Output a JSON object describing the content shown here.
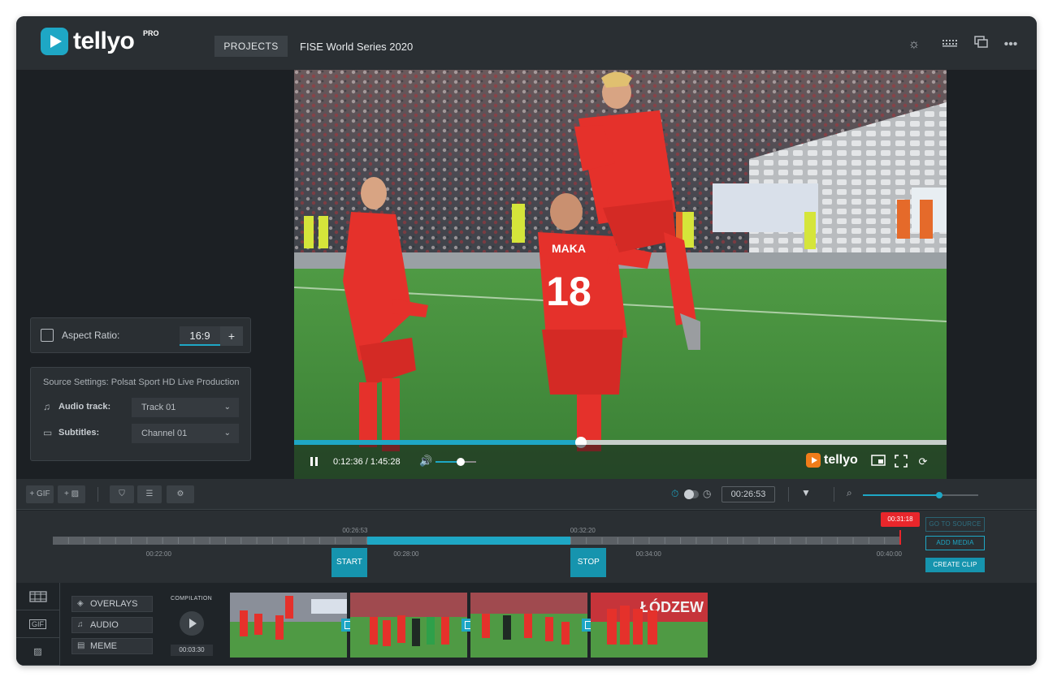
{
  "header": {
    "logo_text": "tellyo",
    "logo_badge": "PRO",
    "projects_label": "PROJECTS",
    "project_title": "FISE World Series 2020",
    "icons": [
      "brightness-icon",
      "keyboard-icon",
      "windows-icon",
      "more-icon"
    ]
  },
  "aspect": {
    "label": "Aspect Ratio:",
    "value": "16:9",
    "add": "+"
  },
  "source": {
    "title": "Source Settings: Polsat Sport HD Live Production",
    "audio_label": "Audio track:",
    "audio_value": "Track 01",
    "subtitles_label": "Subtitles:",
    "subtitles_value": "Channel 01"
  },
  "player": {
    "time": "0:12:36 / 1:45:28",
    "progress": 0.44,
    "volume": 0.62,
    "watermark": "tellyo",
    "jersey_name": "MAKA",
    "jersey_number": "18"
  },
  "toolbar": {
    "gif_label": "+ GIF",
    "img_label": "+",
    "time": "00:26:53",
    "zoom": 0.66
  },
  "timeline": {
    "ticks": [
      {
        "pos": 0.125,
        "label": "00:22:00"
      },
      {
        "pos": 0.417,
        "label": "00:28:00"
      },
      {
        "pos": 0.703,
        "label": "00:34:00"
      },
      {
        "pos": 0.987,
        "label": "00:40:00"
      }
    ],
    "sel_start": 0.371,
    "sel_end": 0.611,
    "start_time": "00:26:53",
    "end_time": "00:32:20",
    "start_label": "START",
    "stop_label": "STOP",
    "playhead": 1.0,
    "playhead_time": "00:31:18",
    "go_to_source": "GO TO SOURCE",
    "add_media": "ADD MEDIA",
    "create_clip": "CREATE CLIP"
  },
  "bottom": {
    "tabs": [
      "filmstrip-icon",
      "GIF",
      "image-icon"
    ],
    "overlays": "OVERLAYS",
    "audio": "AUDIO",
    "meme": "MEME",
    "compilation": "COMPILATION",
    "compilation_time": "00:03:30",
    "banner_text": "ŁÓDZEW"
  },
  "colors": {
    "accent": "#1ea7c5",
    "playhead": "#e8262b",
    "jersey": "#e5312b",
    "pitch": "#3f8a3a"
  }
}
